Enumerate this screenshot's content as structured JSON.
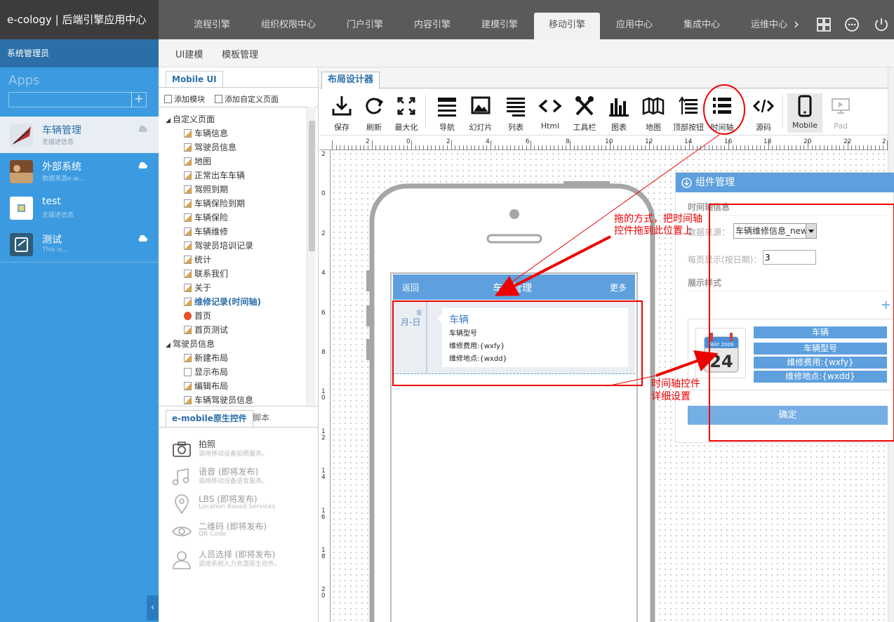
{
  "brand": "e-cology | 后端引擎应用中心",
  "admin_label": "系统管理员",
  "apps_title": "Apps",
  "apps_add": "+",
  "apps": [
    {
      "name": "车辆管理",
      "desc": "无描述信息"
    },
    {
      "name": "外部系统",
      "desc": "数据来源e-w..."
    },
    {
      "name": "test",
      "desc": "无描述信息"
    },
    {
      "name": "测试",
      "desc": "This is..."
    }
  ],
  "collapse_label": "‹",
  "nav_tabs": [
    "流程引擎",
    "组织权限中心",
    "门户引擎",
    "内容引擎",
    "建模引擎",
    "移动引擎",
    "应用中心",
    "集成中心",
    "运维中心"
  ],
  "nav_more": "›",
  "sub_tabs": [
    "UI建模",
    "模板管理"
  ],
  "tree_panel": {
    "tab": "Mobile UI",
    "actions": [
      "添加模块",
      "添加自定义页面"
    ],
    "root": "自定义页面",
    "pages": [
      "车辆信息",
      "驾驶员信息",
      "地图",
      "正常出车车辆",
      "驾照到期",
      "车辆保险到期",
      "车辆保险",
      "车辆维修",
      "驾驶员培训记录",
      "统计",
      "联系我们",
      "关于",
      "维修记录(时间轴)",
      "首页",
      "首页测试"
    ],
    "group2": "驾驶员信息",
    "group2_items": [
      "新建布局",
      "显示布局",
      "编辑布局",
      "车辆驾驶员信息"
    ]
  },
  "controls_panel": {
    "tabs": [
      "e-mobile原生控件",
      "脚本"
    ],
    "items": [
      {
        "name": "拍照",
        "desc": "调用移动设备拍照服务。"
      },
      {
        "name": "语音 (即将发布)",
        "desc": "调用移动设备语音服务。"
      },
      {
        "name": "LBS (即将发布)",
        "desc": "Location Based Services"
      },
      {
        "name": "二维码 (即将发布)",
        "desc": "QR Code"
      },
      {
        "name": "人员选择 (即将发布)",
        "desc": "调用系统人力资源原生控件。"
      }
    ]
  },
  "designer_tab": "布局设计器",
  "toolbar": [
    "保存",
    "刷新",
    "最大化",
    "导航",
    "幻灯片",
    "列表",
    "Html",
    "工具栏",
    "图表",
    "地图",
    "顶部按钮",
    "时间轴",
    "源码",
    "Mobile",
    "Pad"
  ],
  "ruler_h": [
    "2",
    "0",
    "2",
    "4",
    "6",
    "8",
    "10",
    "12",
    "14",
    "16",
    "18",
    "20",
    "22",
    "2"
  ],
  "ruler_v": [
    "2",
    "0",
    "2",
    "4",
    "6",
    "8",
    "1 0",
    "1 2",
    "1 4",
    "1 6",
    "1 8",
    "2 0"
  ],
  "mobile": {
    "back": "返回",
    "title": "车辆管理",
    "more": "更多",
    "timeline": {
      "year": "年",
      "date": "月-日",
      "title": "车辆",
      "lines": [
        "车辆型号",
        "维修费用:{wxfy}",
        "维修地点:{wxdd}"
      ]
    }
  },
  "component_panel": {
    "title": "组件管理",
    "section1": "时间轴信息",
    "datasource_label": "数据来源：",
    "datasource_value": "车辆维修信息_new",
    "perpage_label": "每页显示(按日期)：",
    "perpage_value": "3",
    "section2": "展示样式",
    "add_symbol": "+",
    "calendar": {
      "month": "MAY 2009",
      "day": "24"
    },
    "fields": [
      "车辆",
      "车辆型号",
      "维修费用:{wxfy}",
      "维修地点:{wxdd}"
    ],
    "confirm": "确定"
  },
  "annotations": {
    "drag": [
      "拖的方式，把时间轴",
      "控件拖到此位置上"
    ],
    "detail": [
      "时间轴控件",
      "详细设置"
    ]
  },
  "colors": {
    "accent": "#5ea0de",
    "sidebar": "#3c9be0",
    "annotation": "#e00000"
  }
}
